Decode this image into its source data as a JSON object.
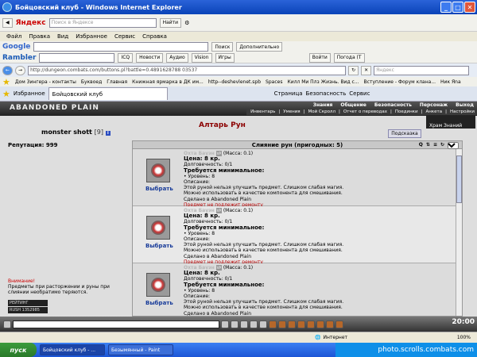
{
  "window": {
    "title": "Бойцовский клуб - Windows Internet Explorer"
  },
  "yandex": {
    "logo": "Яндекс",
    "search_placeholder": "Поиск в Яндексе",
    "search_button": "Найти"
  },
  "menu": {
    "items": [
      "Файл",
      "Правка",
      "Вид",
      "Избранное",
      "Сервис",
      "Справка"
    ]
  },
  "google": {
    "logo": "Google",
    "search_button": "Поиск",
    "more_button": "Дополнительно"
  },
  "rambler": {
    "logo": "Rambler",
    "items": [
      "ICQ",
      "Новости",
      "Аудио",
      "Vision",
      "Игры",
      "Войти",
      "Погода (Т"
    ]
  },
  "address": {
    "url": "http://dungeon.combats.com/buttons.pl?battle=0.4891628788 03537",
    "search_placeholder": "Яндекс"
  },
  "favorites": {
    "label": "Избранное",
    "items": [
      "Дом Зингера - контакты",
      "Буквоед",
      "Главная",
      "Книжная ярмарка в ДК им...",
      "http--deshevlenet.spb",
      "Spaces",
      "Килл Ми Плз Жизнь. Вид с...",
      "Вступление - Форум клана...",
      "Ник Яna"
    ]
  },
  "tab": {
    "title": "Бойцовский клуб",
    "page_menu": "Страница",
    "security_menu": "Безопасность",
    "tools_menu": "Сервис"
  },
  "game": {
    "logo": "ABANDONED PLAIN",
    "top_nav": [
      "Знания",
      "Общение",
      "Безопасность",
      "Персонаж",
      "Выход"
    ],
    "sub_nav": [
      "Инвентарь",
      "Умения",
      "Мой Скролл",
      "Отчет о переводах",
      "Поединки",
      "Анкета",
      "Настройки"
    ],
    "location": "Храм Знаний",
    "character": {
      "name": "monster shott",
      "level": "[9]"
    },
    "reputation_label": "Репутация:",
    "reputation_value": "999",
    "title": "Алтарь Рун",
    "hint_button": "Подсказка",
    "panel_title": "Слияние рун (пригодных: 5)",
    "panel_select": "0",
    "warning_title": "Внимание!",
    "warning_text": "Предметы при расторжении и руны при слиянии необратимо теряются.",
    "counters": [
      {
        "label": "РЕЙТИНГ",
        "value": "34799826"
      },
      {
        "label": "RUSH",
        "value": "1352985"
      }
    ],
    "items": [
      {
        "name": "Охта Бауэн",
        "badge": "VP",
        "mass": "(Масса: 0.1)",
        "price": "Цена: 8 кр.",
        "durability": "Долговечность: 0/1",
        "req_title": "Требуется минимальное:",
        "req_level": "• Уровень: 8",
        "desc_label": "Описание:",
        "desc1": "Этой руной нельзя улучшить предмет. Слишком слабая магия.",
        "desc2": "Можно использовать в качестве компонента для смешивания.",
        "made": "Сделано в Abandoned Plain",
        "repair": "Предмет не подлежит ремонту",
        "choose": "Выбрать"
      },
      {
        "name": "Охта Бауэн",
        "badge": "VP",
        "mass": "(Масса: 0.1)",
        "price": "Цена: 8 кр.",
        "durability": "Долговечность: 0/1",
        "req_title": "Требуется минимальное:",
        "req_level": "• Уровень: 8",
        "desc_label": "Описание:",
        "desc1": "Этой руной нельзя улучшить предмет. Слишком слабая магия.",
        "desc2": "Можно использовать в качестве компонента для смешивания.",
        "made": "Сделано в Abandoned Plain",
        "repair": "Предмет не подлежит ремонту",
        "choose": "Выбрать"
      },
      {
        "name": "Охта Бауэн",
        "badge": "VP",
        "mass": "(Масса: 0.1)",
        "price": "Цена: 8 кр.",
        "durability": "Долговечность: 0/1",
        "req_title": "Требуется минимальное:",
        "req_level": "• Уровень: 8",
        "desc_label": "Описание:",
        "desc1": "Этой руной нельзя улучшить предмет. Слишком слабая магия.",
        "desc2": "Можно использовать в качестве компонента для смешивания.",
        "made": "Сделано в Abandoned Plain",
        "repair": "",
        "choose": "Выбрать"
      }
    ],
    "time": "20:00"
  },
  "status": {
    "zone": "Интернет",
    "zoom": "100%"
  },
  "taskbar": {
    "start": "пуск",
    "tasks": [
      "Бойцовский клуб - ...",
      "Безымянный - Paint"
    ],
    "watermark": "photo.scrolls.combats.com"
  }
}
